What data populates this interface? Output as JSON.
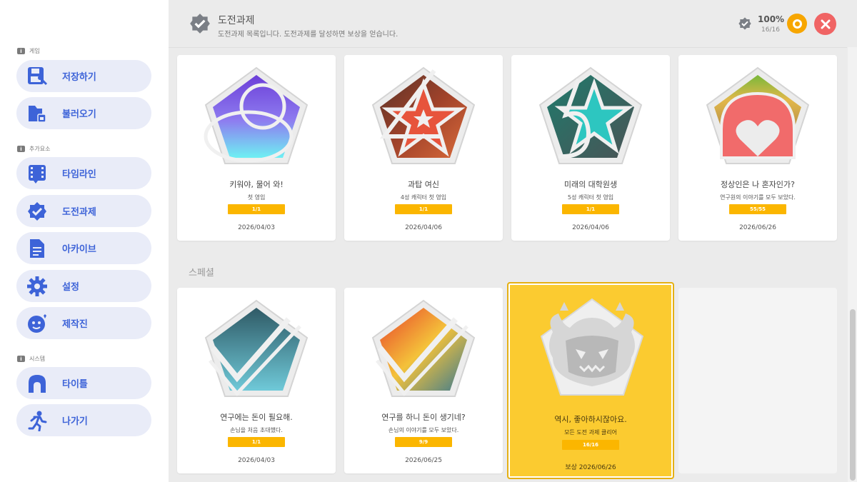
{
  "sidebar": {
    "sections": [
      {
        "label": "게임"
      },
      {
        "label": "추가요소"
      },
      {
        "label": "시스템"
      }
    ],
    "items": [
      {
        "label": "저장하기",
        "icon": "save-icon"
      },
      {
        "label": "불러오기",
        "icon": "load-icon"
      },
      {
        "label": "타임라인",
        "icon": "timeline-icon"
      },
      {
        "label": "도전과제",
        "icon": "achievement-icon"
      },
      {
        "label": "아카이브",
        "icon": "archive-icon"
      },
      {
        "label": "설정",
        "icon": "gear-icon"
      },
      {
        "label": "제작진",
        "icon": "credits-icon"
      },
      {
        "label": "타이틀",
        "icon": "title-icon"
      },
      {
        "label": "나가기",
        "icon": "exit-icon"
      }
    ]
  },
  "header": {
    "title": "도전과제",
    "subtitle": "도전과제 목록입니다. 도전과제를 달성하면 보상을 얻습니다.",
    "percent": "100%",
    "count": "16/16"
  },
  "special_label": "스페셜",
  "colors": {
    "accent": "#3d63d8",
    "progress": "#fbb600",
    "close": "#f06464",
    "coin": "#f7a600",
    "gold_card": "#fbcb30"
  },
  "achievements": [
    {
      "title": "키워야, 물어 와!",
      "desc": "첫 영입",
      "progress": "1/1",
      "date": "2026/04/03"
    },
    {
      "title": "과탑 여신",
      "desc": "4성 캐릭터 첫 영입",
      "progress": "1/1",
      "date": "2026/04/06"
    },
    {
      "title": "미래의 대학원생",
      "desc": "5성 캐릭터 첫 영입",
      "progress": "1/1",
      "date": "2026/04/06"
    },
    {
      "title": "정상인은 나 혼자인가?",
      "desc": "연구원의 이야기를 모두 보았다.",
      "progress": "55/55",
      "date": "2026/06/26"
    }
  ],
  "specials": [
    {
      "title": "연구에는 돈이 필요해.",
      "desc": "손님을 처음 초대했다.",
      "progress": "1/1",
      "date": "2026/04/03"
    },
    {
      "title": "연구를 하니 돈이 생기네?",
      "desc": "손님의 이야기를 모두 보았다.",
      "progress": "9/9",
      "date": "2026/06/25"
    },
    {
      "title": "역시, 좋아하시잖아요.",
      "desc": "모든 도전 과제 클리어",
      "progress": "16/16",
      "date": "보상  2026/06/26"
    }
  ]
}
